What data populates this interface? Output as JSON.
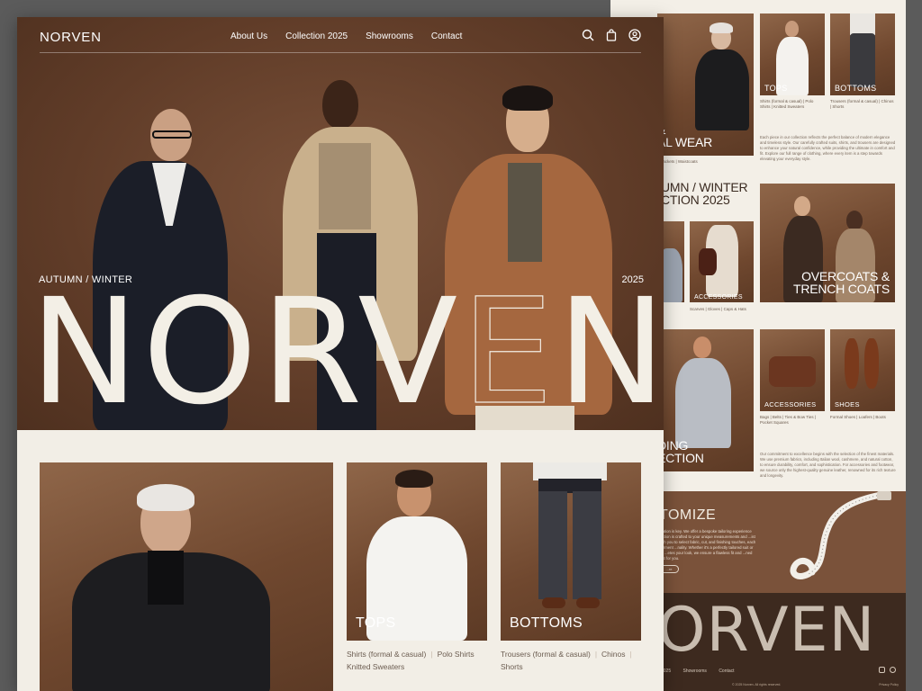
{
  "brand": "NORVEN",
  "nav": {
    "links": [
      "About Us",
      "Collection 2025",
      "Showrooms",
      "Contact"
    ],
    "icons": [
      "search-icon",
      "bag-icon",
      "user-icon"
    ]
  },
  "hero": {
    "season": "AUTUMN / WINTER",
    "year": "2025",
    "wordmark_solid_a": "NORV",
    "wordmark_outline": "E",
    "wordmark_solid_b": "N"
  },
  "cards": {
    "tops": {
      "label": "TOPS",
      "items": [
        "Shirts (formal & casual)",
        "Polo Shirts",
        "Knitted Sweaters"
      ]
    },
    "bottoms": {
      "label": "BOTTOMS",
      "items": [
        "Trousers (formal & casual)",
        "Chinos",
        "Shorts"
      ]
    }
  },
  "back": {
    "top_left_big": "&\nAL WEAR",
    "tops_label": "TOPS",
    "bottoms_label": "BOTTOMS",
    "tops_items": "Shirts (formal & casual) | Polo Shirts | Knitted Sweaters",
    "bottoms_items": "Trousers (formal & casual) | Chinos | Shorts",
    "para1": "Each piece in our collection reflects the perfect balance of modern elegance and timeless style. Our carefully crafted suits, shirts, and trousers are designed to enhance your natural confidence, while providing the ultimate in comfort and fit. Explore our full range of clothing, where every item is a step towards elevating your everyday style.",
    "small_tags_1": "Jackets | Waistcoats",
    "aw_title": "UMN / WINTER\nCTION 2025",
    "accessories_label": "ACCESSORIES",
    "overcoats_label": "OVERCOATS &\nTRENCH COATS",
    "acc_items_1": "Scarves | Gloves | Caps & Hats",
    "accessories2_label": "ACCESSORIES",
    "shoes_label": "SHOES",
    "acc_items_2": "Bags | Belts | Ties & Bow Ties | Pocket Squares",
    "shoe_items": "Formal Shoes | Loafers | Boots",
    "wedding_title": "DING\nECTION",
    "para2": "Our commitment to excellence begins with the selection of the finest materials. We use premium fabrics, including Italian wool, cashmere, and natural cotton, to ensure durability, comfort, and sophistication. For accessories and footwear, we source only the highest-quality genuine leather, renowned for its rich texture and longevity.",
    "customize_title": "TOMIZE",
    "customize_text": "...ation is key. We offer a bespoke tailoring experience ...ction is crafted to your unique measurements and ...ist with you to select fabric, cut, and finishing touches, each garment ...nality. Whether it's a perfectly tailored suit or an ...etes your look, we ensure a flawless fit and ...ned just for you.",
    "customize_btn": "...re",
    "footer_word": "ORVEN",
    "footer_links": [
      "2025",
      "Showrooms",
      "Contact"
    ],
    "copyright": "© 2025 Norven. All rights reserved.",
    "privacy": "Privacy Policy"
  }
}
